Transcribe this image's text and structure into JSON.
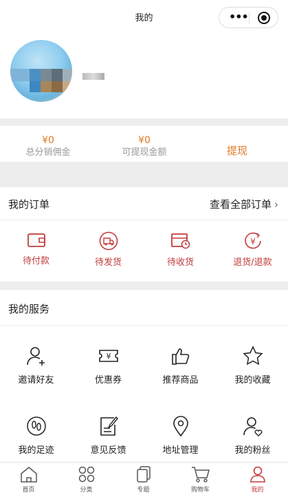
{
  "header": {
    "title": "我的"
  },
  "stats": {
    "total_commission_amount": "¥0",
    "total_commission_label": "总分销佣金",
    "withdrawable_amount": "¥0",
    "withdrawable_label": "可提现金额",
    "withdraw_button": "提现"
  },
  "orders": {
    "title": "我的订单",
    "view_all": "查看全部订单",
    "items": [
      {
        "label": "待付款",
        "icon": "wallet-icon"
      },
      {
        "label": "待发货",
        "icon": "truck-icon"
      },
      {
        "label": "待收货",
        "icon": "receive-icon"
      },
      {
        "label": "退货/退款",
        "icon": "refund-icon"
      }
    ]
  },
  "services": {
    "title": "我的服务",
    "items": [
      {
        "label": "邀请好友",
        "icon": "add-user-icon"
      },
      {
        "label": "优惠券",
        "icon": "coupon-icon"
      },
      {
        "label": "推荐商品",
        "icon": "thumbs-up-icon"
      },
      {
        "label": "我的收藏",
        "icon": "star-icon"
      },
      {
        "label": "我的足迹",
        "icon": "footprint-icon"
      },
      {
        "label": "意见反馈",
        "icon": "feedback-icon"
      },
      {
        "label": "地址管理",
        "icon": "location-icon"
      },
      {
        "label": "我的粉丝",
        "icon": "fans-icon"
      }
    ]
  },
  "tabbar": {
    "items": [
      {
        "label": "首页",
        "icon": "home-icon"
      },
      {
        "label": "分类",
        "icon": "category-icon"
      },
      {
        "label": "专题",
        "icon": "topic-icon"
      },
      {
        "label": "购物车",
        "icon": "cart-icon"
      },
      {
        "label": "我的",
        "icon": "profile-icon",
        "active": true
      }
    ]
  },
  "colors": {
    "accent_orange": "#e07a25",
    "accent_red": "#c23a3a"
  }
}
